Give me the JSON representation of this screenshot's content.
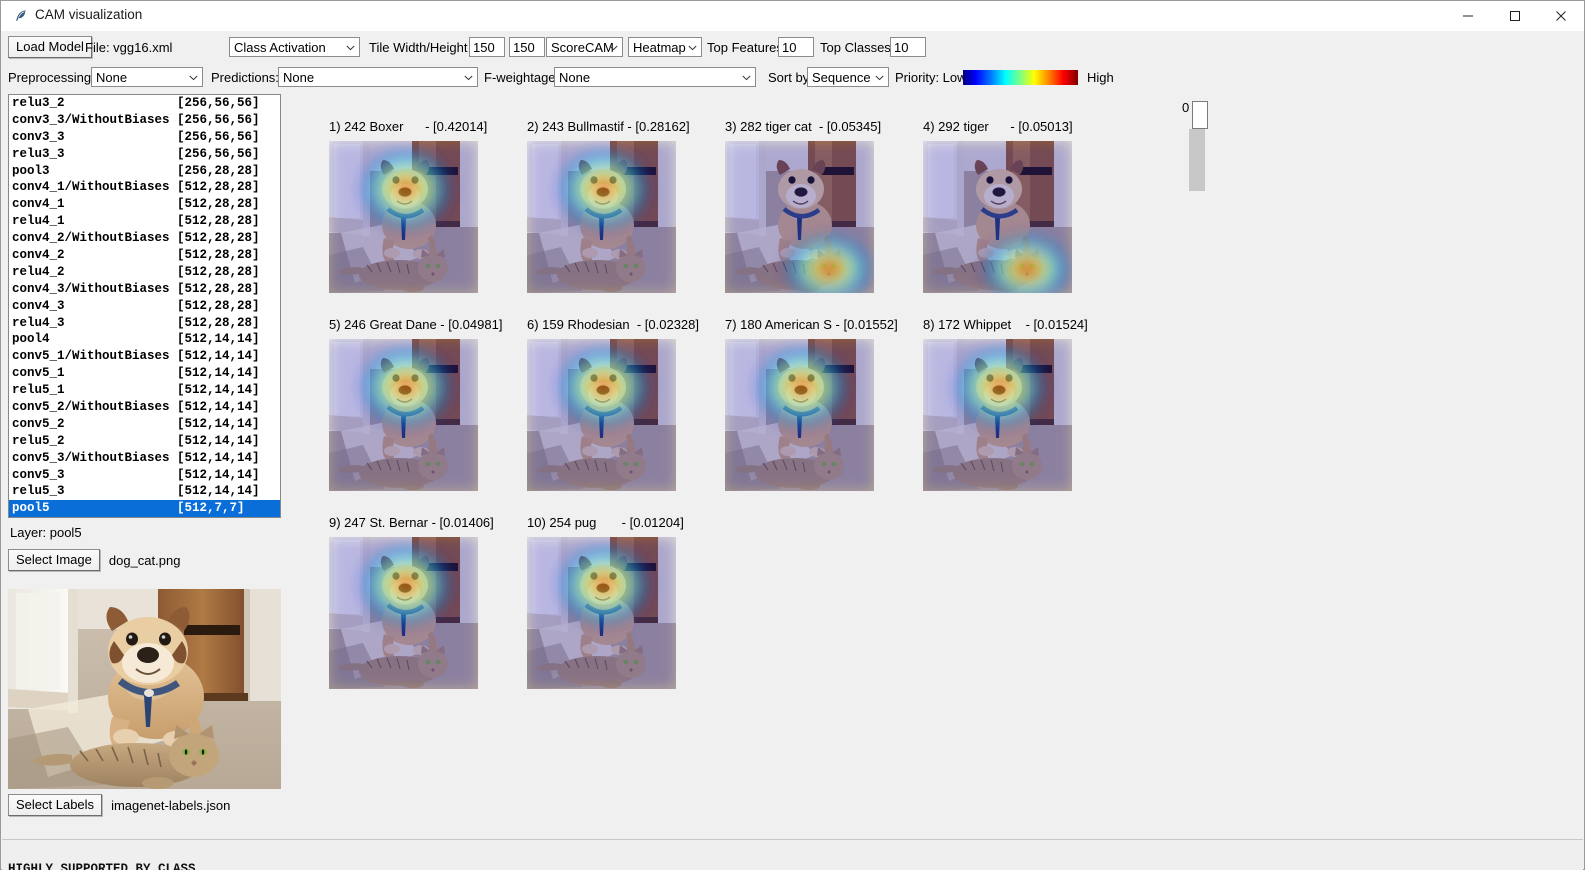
{
  "window": {
    "title": "CAM visualization",
    "icon": "feather-icon",
    "minimize_label": "minimize-icon",
    "maximize_label": "maximize-icon",
    "close_label": "close-icon"
  },
  "toolbar": {
    "load_model_label": "Load Model",
    "file_label": "File: vgg16.xml",
    "cam_mode": "Class Activation",
    "tile_label": "Tile Width/Height",
    "tile_width": "150",
    "tile_height": "150",
    "algorithm": "ScoreCAM",
    "display_mode": "Heatmap",
    "top_features_label": "Top Features",
    "top_features_value": "10",
    "top_classes_label": "Top Classes",
    "top_classes_value": "10",
    "preprocessing_label": "Preprocessing",
    "preprocessing_value": "None",
    "predictions_label": "Predictions:",
    "predictions_value": "None",
    "fweightage_label": "F-weightage:",
    "fweightage_value": "None",
    "sortby_label": "Sort by:",
    "sortby_value": "Sequence",
    "priority_low_label": "Priority: Low",
    "priority_high_label": "High",
    "priority_gradient": "jet-colormap"
  },
  "sidebar": {
    "layer_caption": "Layer:   pool5",
    "select_image_label": "Select Image",
    "image_name": "dog_cat.png",
    "select_labels_label": "Select Labels",
    "labels_name": "imagenet-labels.json",
    "layers": [
      {
        "name": "relu3_2",
        "shape": "[256,56,56]",
        "selected": false
      },
      {
        "name": "conv3_3/WithoutBiases",
        "shape": "[256,56,56]",
        "selected": false
      },
      {
        "name": "conv3_3",
        "shape": "[256,56,56]",
        "selected": false
      },
      {
        "name": "relu3_3",
        "shape": "[256,56,56]",
        "selected": false
      },
      {
        "name": "pool3",
        "shape": "[256,28,28]",
        "selected": false
      },
      {
        "name": "conv4_1/WithoutBiases",
        "shape": "[512,28,28]",
        "selected": false
      },
      {
        "name": "conv4_1",
        "shape": "[512,28,28]",
        "selected": false
      },
      {
        "name": "relu4_1",
        "shape": "[512,28,28]",
        "selected": false
      },
      {
        "name": "conv4_2/WithoutBiases",
        "shape": "[512,28,28]",
        "selected": false
      },
      {
        "name": "conv4_2",
        "shape": "[512,28,28]",
        "selected": false
      },
      {
        "name": "relu4_2",
        "shape": "[512,28,28]",
        "selected": false
      },
      {
        "name": "conv4_3/WithoutBiases",
        "shape": "[512,28,28]",
        "selected": false
      },
      {
        "name": "conv4_3",
        "shape": "[512,28,28]",
        "selected": false
      },
      {
        "name": "relu4_3",
        "shape": "[512,28,28]",
        "selected": false
      },
      {
        "name": "pool4",
        "shape": "[512,14,14]",
        "selected": false
      },
      {
        "name": "conv5_1/WithoutBiases",
        "shape": "[512,14,14]",
        "selected": false
      },
      {
        "name": "conv5_1",
        "shape": "[512,14,14]",
        "selected": false
      },
      {
        "name": "relu5_1",
        "shape": "[512,14,14]",
        "selected": false
      },
      {
        "name": "conv5_2/WithoutBiases",
        "shape": "[512,14,14]",
        "selected": false
      },
      {
        "name": "conv5_2",
        "shape": "[512,14,14]",
        "selected": false
      },
      {
        "name": "relu5_2",
        "shape": "[512,14,14]",
        "selected": false
      },
      {
        "name": "conv5_3/WithoutBiases",
        "shape": "[512,14,14]",
        "selected": false
      },
      {
        "name": "conv5_3",
        "shape": "[512,14,14]",
        "selected": false
      },
      {
        "name": "relu5_3",
        "shape": "[512,14,14]",
        "selected": false
      },
      {
        "name": "pool5",
        "shape": "[512,7,7]",
        "selected": true
      }
    ]
  },
  "results": {
    "items": [
      {
        "caption": "1) 242 Boxer      - [0.42014]",
        "rank": 1,
        "class_id": 242,
        "class_name": "Boxer",
        "score": 0.42014,
        "focus": "dog"
      },
      {
        "caption": "2) 243 Bullmastif - [0.28162]",
        "rank": 2,
        "class_id": 243,
        "class_name": "Bullmastif",
        "score": 0.28162,
        "focus": "dog"
      },
      {
        "caption": "3) 282 tiger cat  - [0.05345]",
        "rank": 3,
        "class_id": 282,
        "class_name": "tiger cat",
        "score": 0.05345,
        "focus": "cat"
      },
      {
        "caption": "4) 292 tiger      - [0.05013]",
        "rank": 4,
        "class_id": 292,
        "class_name": "tiger",
        "score": 0.05013,
        "focus": "cat"
      },
      {
        "caption": "5) 246 Great Dane - [0.04981]",
        "rank": 5,
        "class_id": 246,
        "class_name": "Great Dane",
        "score": 0.04981,
        "focus": "dog"
      },
      {
        "caption": "6) 159 Rhodesian  - [0.02328]",
        "rank": 6,
        "class_id": 159,
        "class_name": "Rhodesian",
        "score": 0.02328,
        "focus": "dog"
      },
      {
        "caption": "7) 180 American S - [0.01552]",
        "rank": 7,
        "class_id": 180,
        "class_name": "American S",
        "score": 0.01552,
        "focus": "dog"
      },
      {
        "caption": "8) 172 Whippet    - [0.01524]",
        "rank": 8,
        "class_id": 172,
        "class_name": "Whippet",
        "score": 0.01524,
        "focus": "dog"
      },
      {
        "caption": "9) 247 St. Bernar - [0.01406]",
        "rank": 9,
        "class_id": 247,
        "class_name": "St. Bernar",
        "score": 0.01406,
        "focus": "dog"
      },
      {
        "caption": "10) 254 pug       - [0.01204]",
        "rank": 10,
        "class_id": 254,
        "class_name": "pug",
        "score": 0.01204,
        "focus": "dog"
      }
    ]
  },
  "pager": {
    "value": "0"
  },
  "bottom": {
    "clipped_text": "HIGHLY_SUPPORTED_BY_CLASS"
  }
}
